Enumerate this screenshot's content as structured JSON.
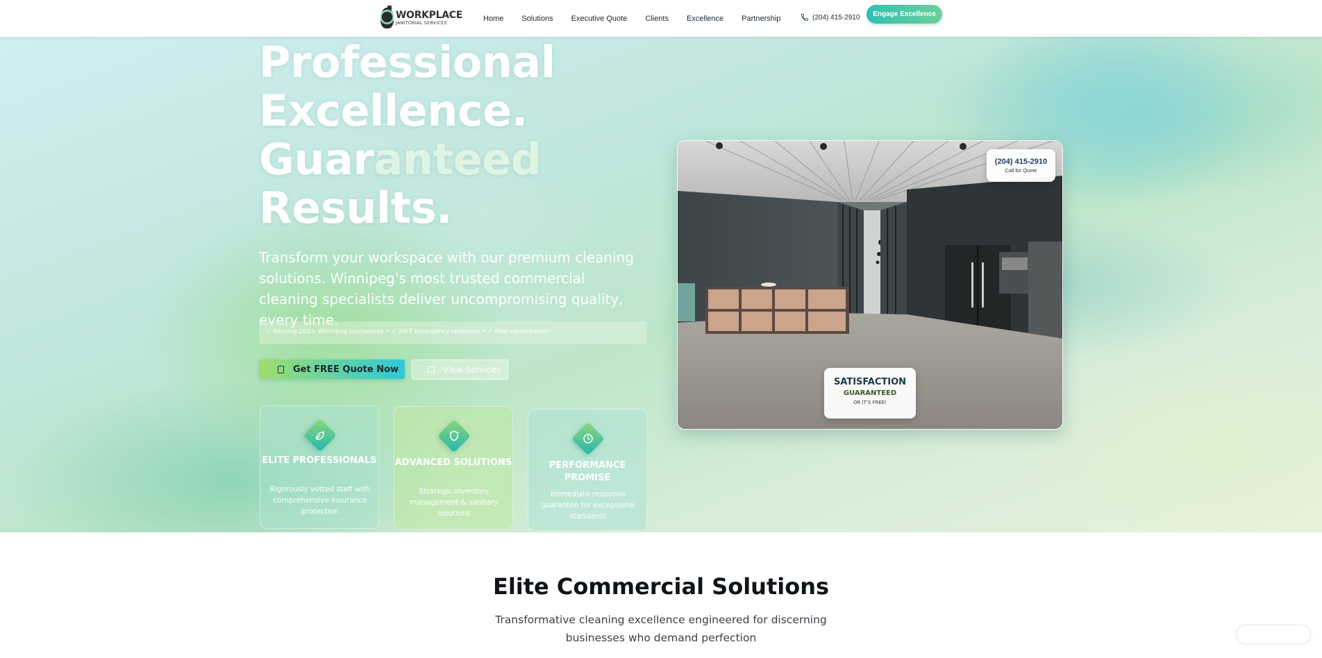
{
  "nav": {
    "logo_main": "WORKPLACE",
    "logo_sub": "JANITORIAL SERVICES",
    "links": [
      "Home",
      "Solutions",
      "Executive Quote",
      "Clients",
      "Excellence",
      "Partnership"
    ],
    "phone": "(204) 415-2910",
    "cta": "Engage Excellence"
  },
  "hero": {
    "title_line1": "Professional",
    "title_line2": "Excellence.",
    "title_line3a": "Guar",
    "title_line3b": "anteed",
    "title_line4": "Results.",
    "description": "Transform your workspace with our premium cleaning solutions. Winnipeg's most trusted commercial cleaning specialists deliver uncompromising quality, every time.",
    "trust_bar": "✓ Serving 200+ Winnipeg businesses • ✓ 24/7 emergency response • ✓ Free consultation",
    "primary_button": "Get FREE Quote Now",
    "secondary_button": "View Services",
    "features": [
      {
        "title": "ELITE PROFESSIONALS",
        "description": "Rigorously vetted staff with comprehensive insurance protection",
        "icon": "leaf-icon"
      },
      {
        "title": "ADVANCED SOLUTIONS",
        "description": "Strategic inventory management & sanitary solutions",
        "icon": "shield-icon"
      },
      {
        "title": "PERFORMANCE PROMISE",
        "description": "Immediate response guarantee for exceptional standards",
        "icon": "clock-icon"
      }
    ]
  },
  "photo": {
    "phone_number": "(204) 415-2910",
    "phone_caption": "Call for Quote",
    "badge_line1": "SATISFACTION",
    "badge_line2": "GUARANTEED",
    "badge_line3": "OR IT'S FREE!"
  },
  "solutions": {
    "title": "Elite Commercial Solutions",
    "subtitle": "Transformative cleaning excellence engineered for discerning businesses who demand perfection"
  },
  "colors": {
    "accent_teal": "#2fbfb2",
    "accent_green": "#6fd09a",
    "heading_dark": "#111417"
  }
}
